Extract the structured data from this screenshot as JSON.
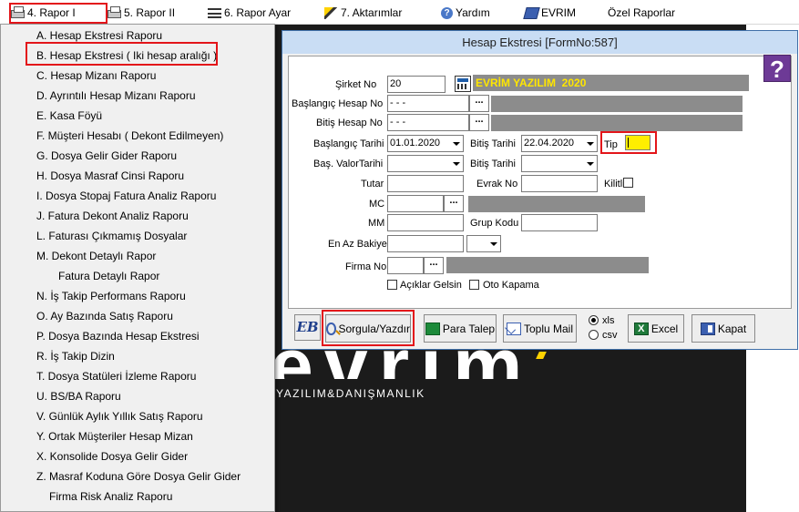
{
  "menubar": {
    "items": [
      {
        "label": "4.  Rapor I",
        "icon": "printer-icon"
      },
      {
        "label": "5.  Rapor II",
        "icon": "printer-icon"
      },
      {
        "label": "6.  Rapor Ayar",
        "icon": "list-icon"
      },
      {
        "label": "7.  Aktarımlar",
        "icon": "wand-icon"
      },
      {
        "label": "Yardım",
        "icon": "help-icon"
      },
      {
        "label": "EVRIM",
        "icon": "evrim-icon"
      },
      {
        "label": "Özel Raporlar",
        "icon": ""
      }
    ]
  },
  "dropdown": {
    "items": [
      {
        "label": "A.  Hesap Ekstresi Raporu"
      },
      {
        "label": "B.  Hesap Ekstresi ( Iki hesap aralığı )"
      },
      {
        "label": "C.  Hesap Mizanı Raporu"
      },
      {
        "label": "D.  Ayrıntılı Hesap Mizanı Raporu"
      },
      {
        "label": "E.  Kasa Föyü"
      },
      {
        "label": "F.  Müşteri Hesabı ( Dekont Edilmeyen)"
      },
      {
        "label": "G.  Dosya Gelir Gider Raporu"
      },
      {
        "label": "H.  Dosya Masraf Cinsi Raporu"
      },
      {
        "label": "I.  Dosya Stopaj Fatura Analiz Raporu"
      },
      {
        "label": "J.  Fatura Dekont Analiz Raporu"
      },
      {
        "label": "L.  Faturası Çıkmamış Dosyalar"
      },
      {
        "label": "M.  Dekont Detaylı Rapor"
      },
      {
        "label": "Fatura Detaylı Rapor"
      },
      {
        "label": "N.  İş Takip Performans Raporu"
      },
      {
        "label": "O.  Ay Bazında Satış Raporu"
      },
      {
        "label": "P.  Dosya Bazında Hesap Ekstresi"
      },
      {
        "label": "R.  İş Takip Dizin"
      },
      {
        "label": "T.  Dosya Statüleri İzleme Raporu"
      },
      {
        "label": "U.  BS/BA Raporu"
      },
      {
        "label": "V.  Günlük Aylık Yıllık Satış Raporu"
      },
      {
        "label": "Y.  Ortak Müşteriler Hesap Mizan"
      },
      {
        "label": "X.  Konsolide Dosya Gelir Gider"
      },
      {
        "label": "Z.  Masraf Koduna Göre Dosya Gelir Gider"
      },
      {
        "label": "Firma Risk Analiz Raporu"
      }
    ]
  },
  "logo": {
    "brand": "evrim",
    "tagline": "YAZILIM&DANIŞMANLIK"
  },
  "form": {
    "title": "Hesap Ekstresi [FormNo:587]",
    "help_glyph": "?",
    "labels": {
      "sirket_no": "Şirket No",
      "baslangic_hesap": "Başlangıç Hesap No",
      "bitis_hesap": "Bitiş Hesap No",
      "baslangic_tarihi": "Başlangıç Tarihi",
      "bitis_tarihi": "Bitiş Tarihi",
      "tip": "Tip",
      "bas_valor": "Baş. ValorTarihi",
      "bitis_tarihi2": "Bitiş Tarihi",
      "tutar": "Tutar",
      "evrak_no": "Evrak No",
      "kilitli": "Kilitli",
      "mc": "MC",
      "mm": "MM",
      "grup_kodu": "Grup Kodu",
      "en_az_bakiye": "En Az Bakiye",
      "firma_no": "Firma No",
      "aciklar_gelsin": "Açıklar Gelsin",
      "oto_kapama": "Oto Kapama"
    },
    "values": {
      "sirket_no": "20",
      "company_name": "EVRİM YAZILIM  2020",
      "baslangic_hesap": " -  -  -",
      "bitis_hesap": " -  -  -",
      "baslangic_tarihi": "01.01.2020",
      "bitis_tarihi": "22.04.2020",
      "ellipsis": "..."
    }
  },
  "buttons": {
    "logo_text": "EB",
    "sorgula": "Sorgula/Yazdır",
    "para_talep": "Para Talep",
    "toplu_mail": "Toplu Mail",
    "xls": "xls",
    "csv": "csv",
    "excel": "Excel",
    "excel_icon": "X",
    "kapat": "Kapat"
  },
  "colors": {
    "highlight": "#e3151a",
    "title_bar": "#c9ddf4",
    "company_text": "#ffe600",
    "tip_field": "#ffee00"
  }
}
